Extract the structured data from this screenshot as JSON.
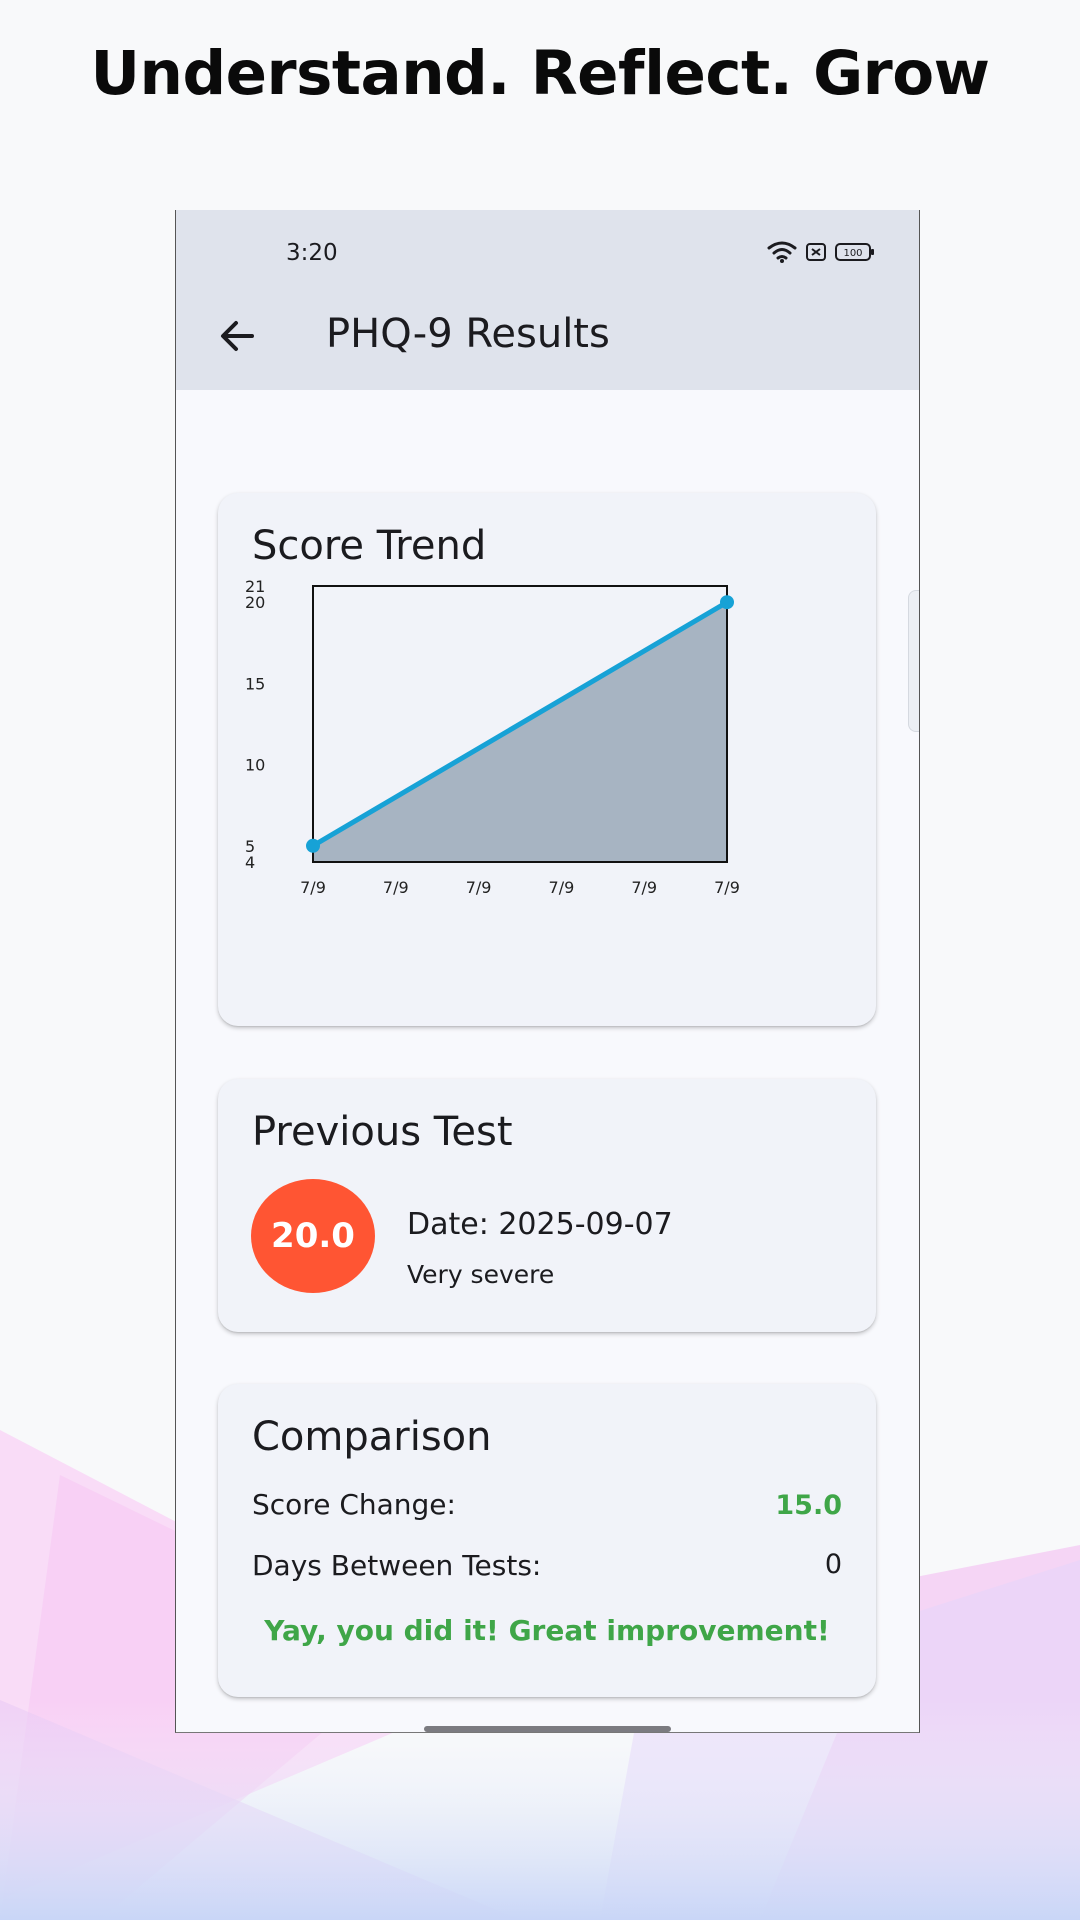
{
  "headline": "Understand. Reflect. Grow",
  "status_bar": {
    "time": "3:20",
    "battery": "100",
    "icons": [
      "wifi-icon",
      "no-sim-icon",
      "battery-icon"
    ]
  },
  "app_bar": {
    "title": "PHQ-9 Results",
    "back_icon": "arrow-left-icon"
  },
  "score_trend": {
    "title": "Score Trend"
  },
  "chart_data": {
    "type": "area",
    "title": "Score Trend",
    "xlabel": "",
    "ylabel": "",
    "x": [
      "7/9",
      "7/9",
      "7/9",
      "7/9",
      "7/9",
      "7/9"
    ],
    "values": [
      5,
      20
    ],
    "y_ticks": [
      4,
      5,
      10,
      15,
      20,
      21
    ],
    "ylim": [
      4,
      21
    ],
    "line_color": "#17a2d6",
    "fill_color": "#a7b4c2",
    "grid": false
  },
  "previous_test": {
    "title": "Previous Test",
    "score": "20.0",
    "date": "Date: 2025-09-07",
    "severity": "Very severe",
    "badge_color": "#ff5533"
  },
  "comparison": {
    "title": "Comparison",
    "score_change_label": "Score Change:",
    "score_change_value": "15.0",
    "days_label": "Days Between Tests:",
    "days_value": "0",
    "message": "Yay, you did it! Great improvement!",
    "positive_color": "#3fa648"
  }
}
